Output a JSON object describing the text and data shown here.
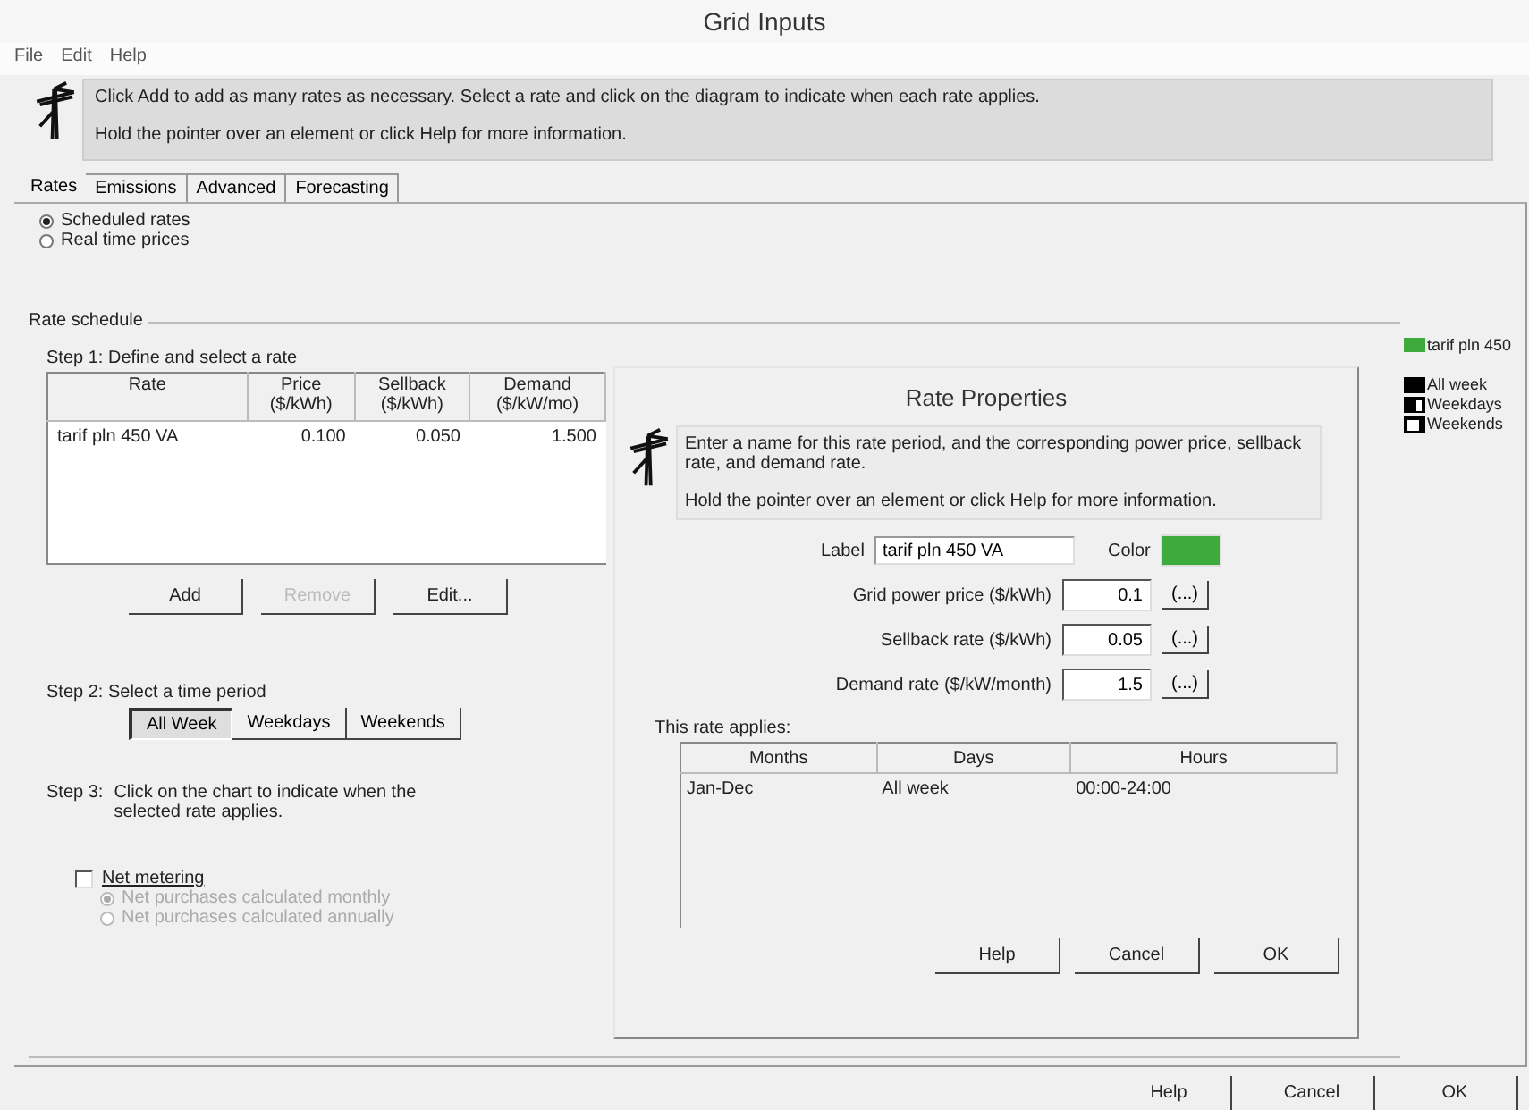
{
  "window": {
    "title": "Grid Inputs"
  },
  "menu": [
    "File",
    "Edit",
    "Help"
  ],
  "info": [
    "Click Add to add as many rates as necessary.  Select a rate and click on the diagram to indicate when each rate applies.",
    "Hold the pointer over an element or click Help for more information."
  ],
  "tabs": [
    {
      "label": "Rates",
      "selected": true
    },
    {
      "label": "Emissions",
      "selected": false
    },
    {
      "label": "Advanced",
      "selected": false
    },
    {
      "label": "Forecasting",
      "selected": false
    }
  ],
  "rate_mode": [
    {
      "label": "Scheduled rates",
      "selected": true
    },
    {
      "label": "Real time prices",
      "selected": false
    }
  ],
  "rate_schedule": {
    "title": "Rate schedule",
    "step1": "Step 1:  Define and select a rate",
    "columns": [
      {
        "lines": [
          "Rate"
        ]
      },
      {
        "lines": [
          "Price",
          "($/kWh)"
        ]
      },
      {
        "lines": [
          "Sellback",
          "($/kWh)"
        ]
      },
      {
        "lines": [
          "Demand",
          "($/kW/mo)"
        ]
      }
    ],
    "rows": [
      {
        "cells": [
          "tarif pln 450 VA",
          "0.100",
          "0.050",
          "1.500"
        ]
      }
    ],
    "buttons": [
      {
        "label": "Add",
        "disabled": false
      },
      {
        "label": "Remove",
        "disabled": true
      },
      {
        "label": "Edit...",
        "disabled": false
      }
    ],
    "step2": "Step 2:  Select a time period",
    "periods": [
      {
        "label": "All Week",
        "selected": true
      },
      {
        "label": "Weekdays",
        "selected": false
      },
      {
        "label": "Weekends",
        "selected": false
      }
    ],
    "step3_label": "Step 3:",
    "step3_text": "Click on the chart to indicate when the selected rate applies.",
    "net_metering": {
      "label": "Net metering",
      "checked": false,
      "options": [
        {
          "label": "Net purchases calculated monthly",
          "selected": true
        },
        {
          "label": "Net purchases calculated annually",
          "selected": false
        }
      ]
    }
  },
  "legend": {
    "rates": [
      {
        "label": "tarif pln 450",
        "color": "#3caa3c"
      }
    ],
    "periods": [
      {
        "label": "All week",
        "kind": "all"
      },
      {
        "label": "Weekdays",
        "kind": "weekdays"
      },
      {
        "label": "Weekends",
        "kind": "weekends"
      }
    ]
  },
  "dialog": {
    "title": "Rate Properties",
    "info": [
      "Enter a name for this rate period, and the corresponding power price, sellback rate, and demand rate.",
      "Hold the pointer over an element or click Help for more information."
    ],
    "label_field": {
      "label": "Label",
      "value": "tarif pln 450 VA"
    },
    "color": {
      "label": "Color",
      "color": "#3caa3c"
    },
    "fields": [
      {
        "label": "Grid power price ($/kWh)",
        "value": "0.1",
        "button": "(...)"
      },
      {
        "label": "Sellback rate ($/kWh)",
        "value": "0.05",
        "button": "(...)"
      },
      {
        "label": "Demand rate ($/kW/month)",
        "value": "1.5",
        "button": "(...)"
      }
    ],
    "applies": {
      "title": "This rate applies:",
      "columns": [
        "Months",
        "Days",
        "Hours"
      ],
      "rows": [
        [
          "Jan-Dec",
          "All week",
          "00:00-24:00"
        ]
      ]
    },
    "buttons": [
      "Help",
      "Cancel",
      "OK"
    ]
  },
  "footer_buttons": [
    "Help",
    "Cancel",
    "OK"
  ]
}
